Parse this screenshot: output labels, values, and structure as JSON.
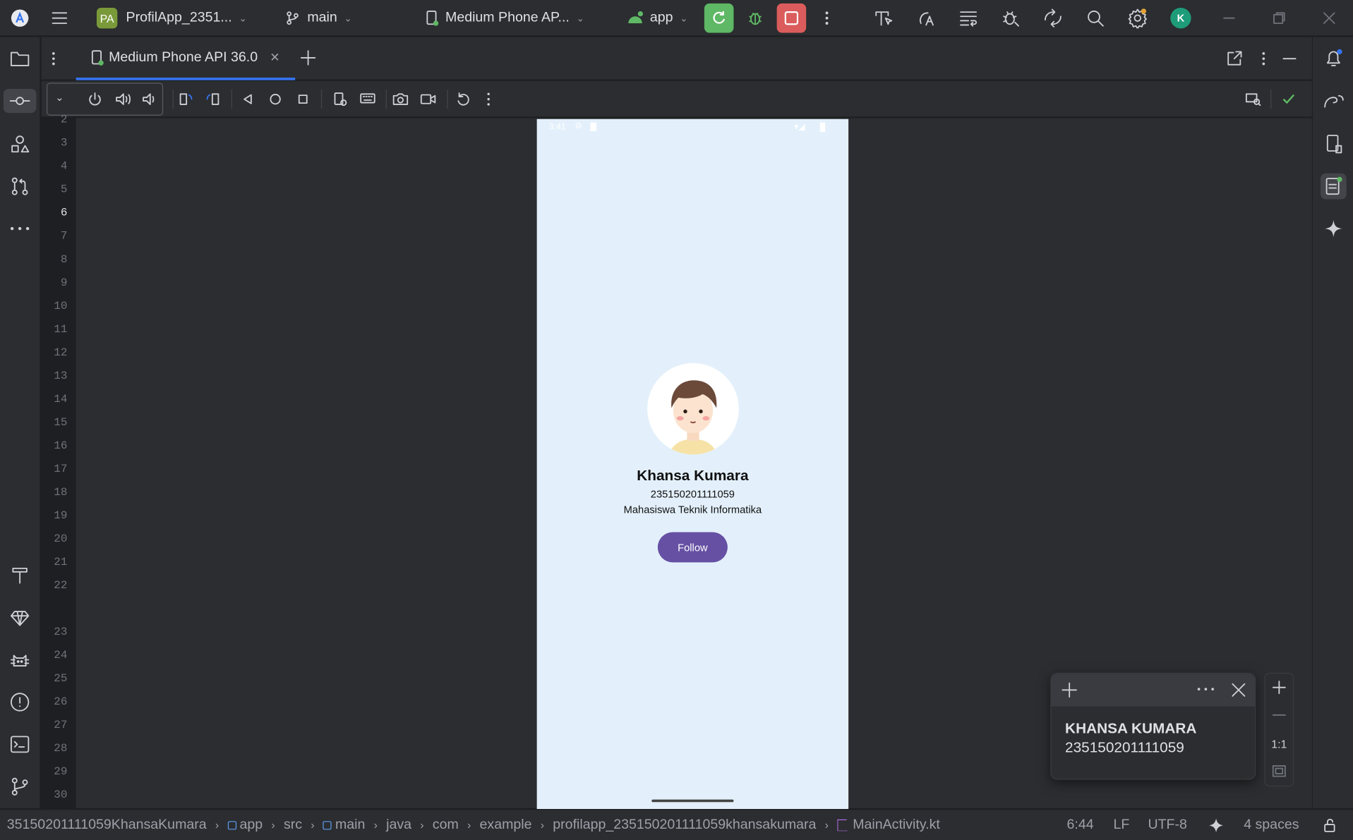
{
  "titlebar": {
    "project_badge": "PA",
    "project_name": "ProfilApp_2351...",
    "branch": "main",
    "device": "Medium Phone AP...",
    "run_config": "app",
    "avatar_letter": "K"
  },
  "tabs": [
    {
      "label": "Medium Phone API 36.0"
    }
  ],
  "line_numbers": [
    "2",
    "3",
    "4",
    "5",
    "6",
    "7",
    "8",
    "9",
    "10",
    "11",
    "12",
    "13",
    "14",
    "15",
    "16",
    "17",
    "18",
    "19",
    "20",
    "21",
    "22",
    "23",
    "24",
    "25",
    "26",
    "27",
    "28",
    "29",
    "30"
  ],
  "phone": {
    "status_time": "3:41",
    "name": "Khansa Kumara",
    "nim": "235150201111059",
    "description": "Mahasiswa Teknik Informatika",
    "follow_label": "Follow",
    "background": "#e3f0fb",
    "accent": "#6650a4"
  },
  "floating_text": {
    "line1": "KHANSA KUMARA",
    "line2": "235150201111059"
  },
  "zoom": {
    "ratio_label": "1:1"
  },
  "breadcrumb": {
    "root": "35150201111059KhansaKumara",
    "items": [
      "app",
      "src",
      "main",
      "java",
      "com",
      "example",
      "profilapp_235150201111059khansakumara",
      "MainActivity.kt"
    ]
  },
  "statusbar": {
    "position": "6:44",
    "line_sep": "LF",
    "encoding": "UTF-8",
    "indent": "4 spaces"
  }
}
